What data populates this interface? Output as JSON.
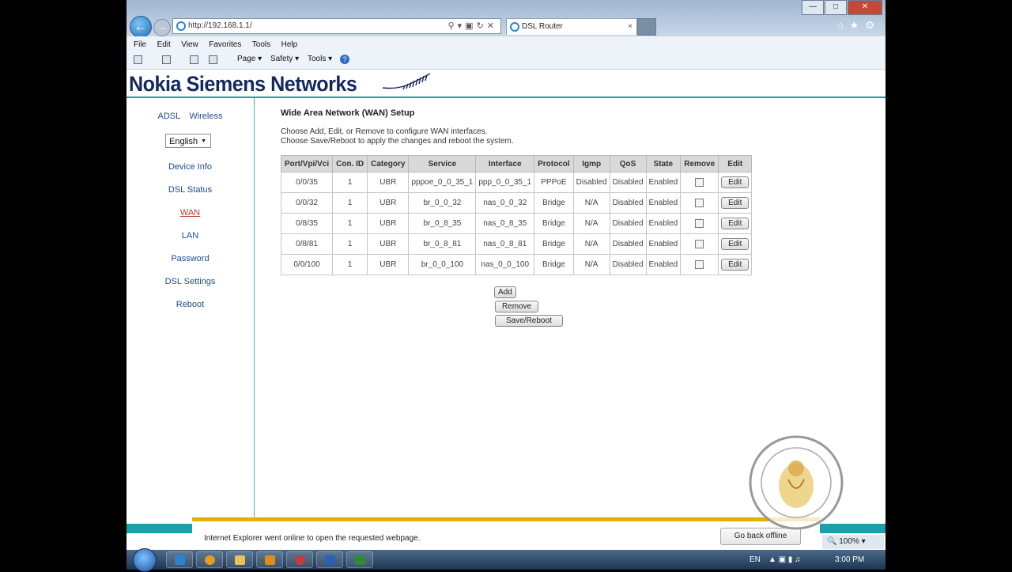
{
  "window": {
    "url": "http://192.168.1.1/",
    "tab_title": "DSL Router",
    "tab_close": "×",
    "controls": {
      "minimize": "—",
      "maximize": "□",
      "close": "✕"
    }
  },
  "menu": [
    "File",
    "Edit",
    "View",
    "Favorites",
    "Tools",
    "Help"
  ],
  "command_bar": {
    "page": "Page ▾",
    "safety": "Safety ▾",
    "tools": "Tools ▾",
    "help": "?"
  },
  "brand": {
    "logo_text": "Nokia Siemens Networks"
  },
  "sidebar": {
    "top_links": [
      "ADSL",
      "Wireless"
    ],
    "language": "English",
    "items": [
      {
        "label": "Device Info",
        "active": false
      },
      {
        "label": "DSL Status",
        "active": false
      },
      {
        "label": "WAN",
        "active": true
      },
      {
        "label": "LAN",
        "active": false
      },
      {
        "label": "Password",
        "active": false
      },
      {
        "label": "DSL Settings",
        "active": false
      },
      {
        "label": "Reboot",
        "active": false
      }
    ]
  },
  "main": {
    "title": "Wide Area Network (WAN) Setup",
    "desc1": "Choose Add, Edit, or Remove to configure WAN interfaces.",
    "desc2": "Choose Save/Reboot to apply the changes and reboot the system.",
    "columns": [
      "Port/Vpi/Vci",
      "Con. ID",
      "Category",
      "Service",
      "Interface",
      "Protocol",
      "Igmp",
      "QoS",
      "State",
      "Remove",
      "Edit"
    ],
    "rows": [
      [
        "0/0/35",
        "1",
        "UBR",
        "pppoe_0_0_35_1",
        "ppp_0_0_35_1",
        "PPPoE",
        "Disabled",
        "Disabled",
        "Enabled"
      ],
      [
        "0/0/32",
        "1",
        "UBR",
        "br_0_0_32",
        "nas_0_0_32",
        "Bridge",
        "N/A",
        "Disabled",
        "Enabled"
      ],
      [
        "0/8/35",
        "1",
        "UBR",
        "br_0_8_35",
        "nas_0_8_35",
        "Bridge",
        "N/A",
        "Disabled",
        "Enabled"
      ],
      [
        "0/8/81",
        "1",
        "UBR",
        "br_0_8_81",
        "nas_0_8_81",
        "Bridge",
        "N/A",
        "Disabled",
        "Enabled"
      ],
      [
        "0/0/100",
        "1",
        "UBR",
        "br_0_0_100",
        "nas_0_0_100",
        "Bridge",
        "N/A",
        "Disabled",
        "Enabled"
      ]
    ],
    "edit_label": "Edit",
    "buttons": {
      "add": "Add",
      "remove": "Remove",
      "save": "Save/Reboot"
    }
  },
  "notification": {
    "message": "Internet Explorer went online to open the requested webpage.",
    "button": "Go back offline"
  },
  "status": {
    "zoom": "100%"
  },
  "tray": {
    "lang": "EN",
    "time": "3:00 PM"
  },
  "colors": {
    "accent_teal": "#1aa0ab",
    "brand_navy": "#13285d",
    "link_blue": "#1e4b91",
    "active_red": "#c0392b",
    "notify_yellow": "#e2b100"
  }
}
